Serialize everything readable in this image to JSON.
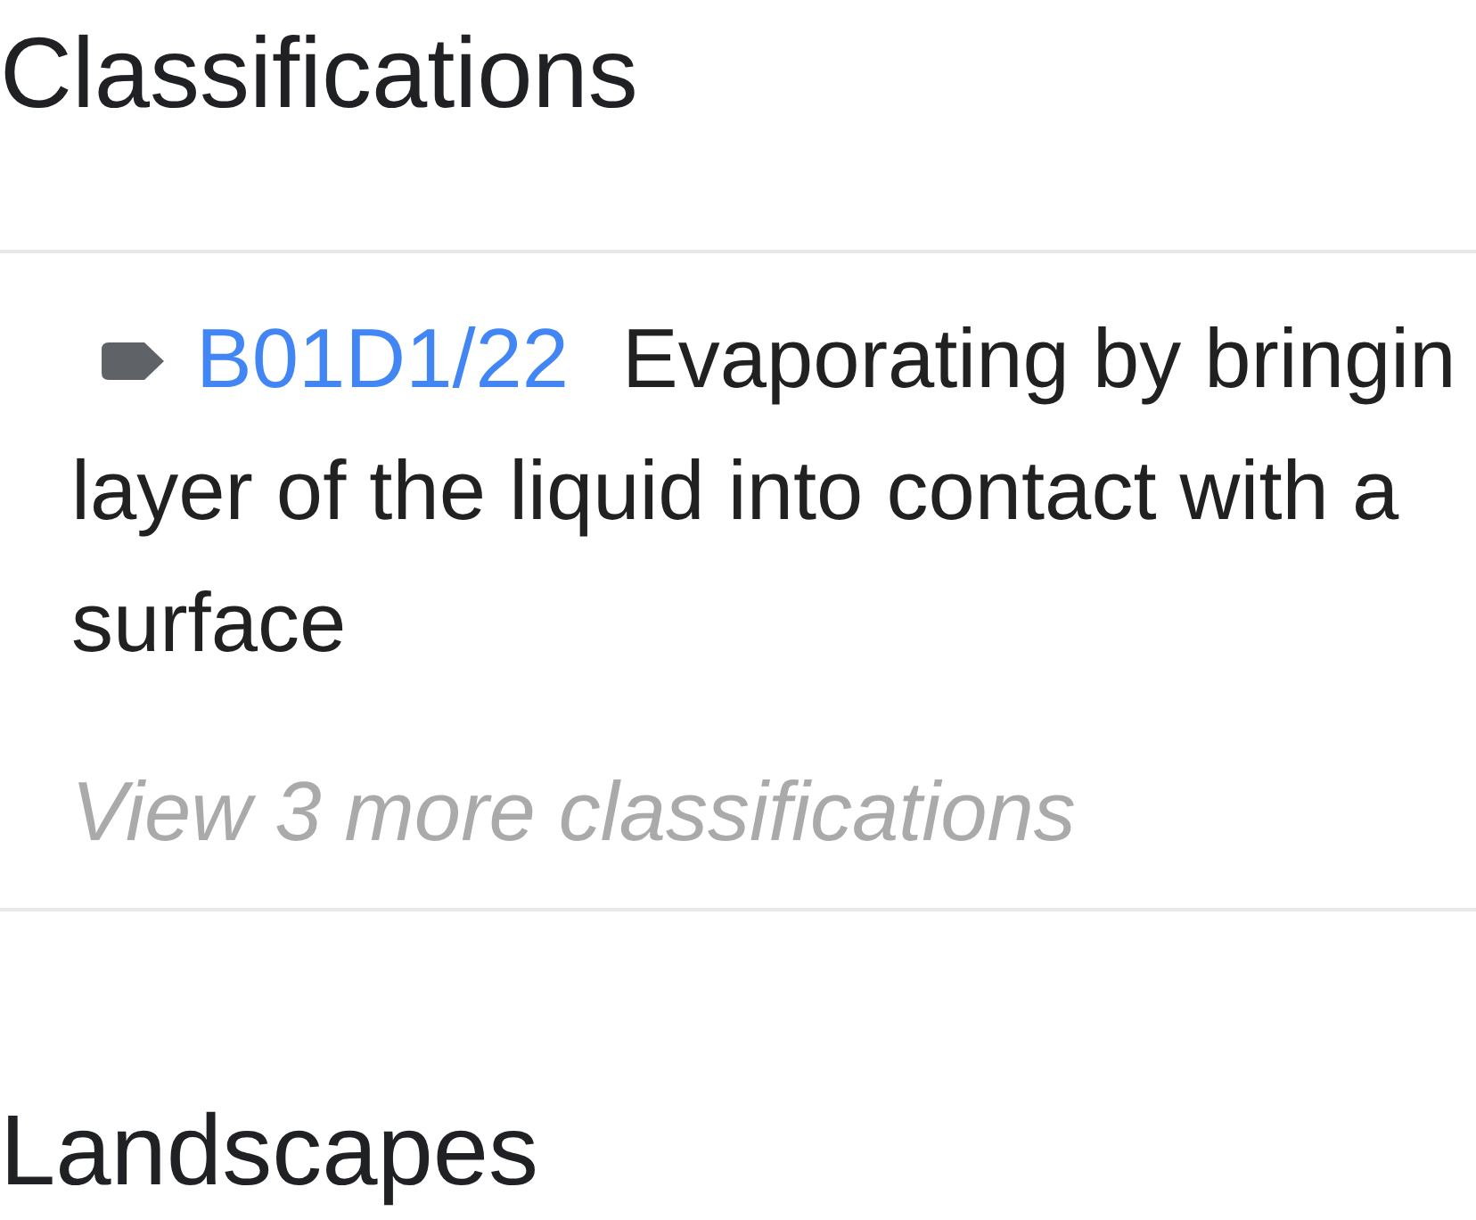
{
  "classifications": {
    "title": "Classifications",
    "items": [
      {
        "code": "B01D1/22",
        "description_lines": [
          "Evaporating by bringin",
          "layer of the liquid into contact with a",
          "surface"
        ]
      }
    ],
    "more_link": "View 3 more classifications"
  },
  "landscapes": {
    "title": "Landscapes"
  }
}
